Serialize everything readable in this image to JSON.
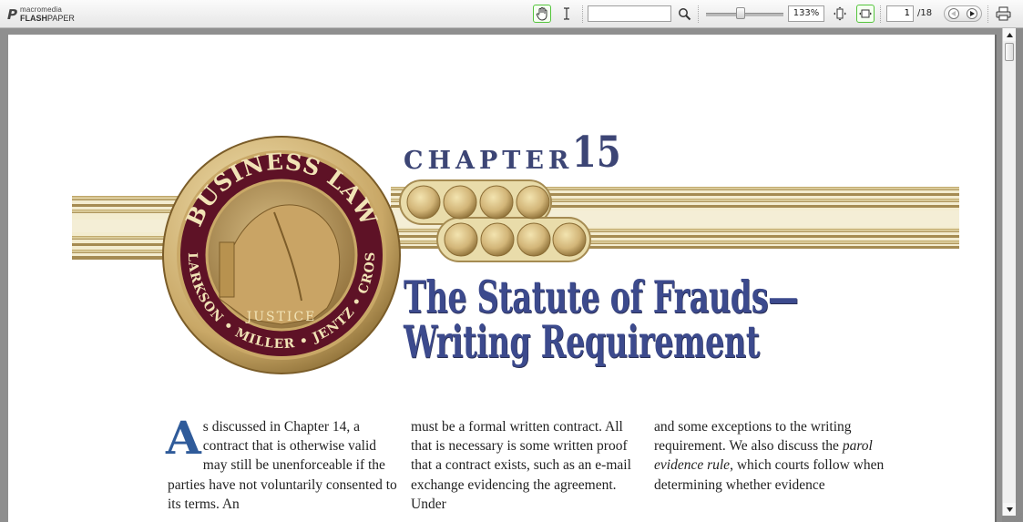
{
  "app": {
    "logo_brand": "macromedia",
    "logo_product_bold": "FLASH",
    "logo_product": "PAPER",
    "logo_icon": "flashpaper-logo-icon"
  },
  "toolbar": {
    "hand_tool_icon": "hand-icon",
    "text_select_icon": "text-cursor-icon",
    "search_value": "",
    "search_icon": "search-icon",
    "zoom_percent": 133,
    "zoom_label": "133%",
    "zoom_slider_fraction": 0.45,
    "fit_page_icon": "fit-page-icon",
    "fit_width_icon": "fit-width-icon",
    "current_page": "1",
    "total_pages": "/18",
    "prev_icon": "prev-page-icon",
    "next_icon": "next-page-icon",
    "print_icon": "print-icon",
    "selection_color": "#54c43c"
  },
  "document": {
    "chapter_label": "CHAPTER",
    "chapter_number": "15",
    "title_line1": "The Statute of Frauds—",
    "title_line2": "Writing Requirement",
    "title_color": "#3c4a8d",
    "seal": {
      "top_text": "BUSINESS LAW",
      "left_text": "CLARKSON",
      "right_text": "CROSS",
      "bottom_text": "MILLER • JENTZ",
      "inner_text": "JUSTICE"
    },
    "column1_dropcap": "A",
    "column1_body": "s discussed in Chapter 14, a contract that is otherwise valid may still be unenforceable if the parties have not voluntarily consented to its terms. An",
    "column2_body": "must be a formal written contract. All that is necessary is some written proof that a contract exists, such as an e-mail exchange evidencing the agreement. Under",
    "column3_part1": "and some exceptions to the writing requirement. We also discuss the ",
    "column3_italic": "parol evidence rule",
    "column3_part2": ", which courts follow when determining whether evidence",
    "dropcap_color": "#2f5b9a"
  }
}
